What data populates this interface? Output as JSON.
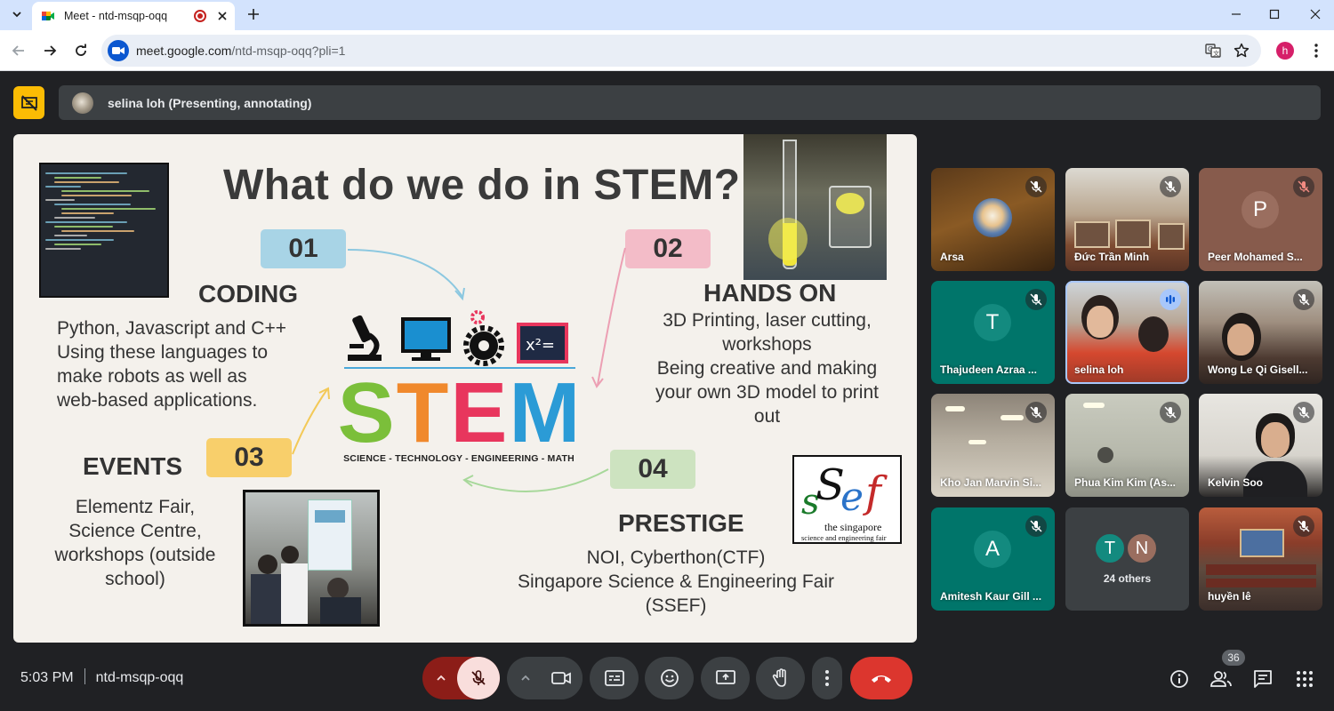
{
  "browser": {
    "tab_title": "Meet - ntd-msqp-oqq",
    "url_host": "meet.google.com",
    "url_path": "/ntd-msqp-oqq?pli=1",
    "profile_initial": "h"
  },
  "header": {
    "presenter_text": "selina loh (Presenting, annotating)"
  },
  "slide": {
    "title": "What do we do in STEM?",
    "stem_letters": [
      "S",
      "T",
      "E",
      "M"
    ],
    "stem_colors": [
      "#7bbf3a",
      "#f0892c",
      "#e8365d",
      "#2b9bd6"
    ],
    "stem_tagline": "SCIENCE - TECHNOLOGY - ENGINEERING - MATH",
    "sections": {
      "coding": {
        "num": "01",
        "heading": "CODING",
        "lines": [
          "Python, Javascript and C++",
          "Using these languages to",
          "make robots as well as",
          "web-based applications."
        ]
      },
      "hands_on": {
        "num": "02",
        "heading": "HANDS ON",
        "lines": [
          "3D Printing, laser cutting,",
          "workshops",
          "Being creative and making",
          "your own 3D model to print",
          "out"
        ]
      },
      "events": {
        "num": "03",
        "heading": "EVENTS",
        "lines": [
          "Elementz Fair,",
          "Science Centre,",
          "workshops (outside",
          "school)"
        ]
      },
      "prestige": {
        "num": "04",
        "heading": "PRESTIGE",
        "lines": [
          "NOI, Cyberthon(CTF)",
          "Singapore Science & Engineering Fair",
          "(SSEF)"
        ]
      }
    },
    "ssef_logo": {
      "letters": [
        "s",
        "S",
        "e",
        "f"
      ],
      "caption1": "the singapore",
      "caption2": "science and engineering fair"
    },
    "badge_colors": {
      "b1": "#a8d4e6",
      "b2": "#f3bcc8",
      "b3": "#f8cf6b",
      "b4": "#cde3c0"
    }
  },
  "participants": [
    {
      "name": "Arsa",
      "kind": "avatar-image",
      "muted": true
    },
    {
      "name": "Đức Trần Minh",
      "kind": "video",
      "muted": true
    },
    {
      "name": "Peer Mohamed S...",
      "kind": "letter",
      "letter": "P",
      "muted": true
    },
    {
      "name": "Thajudeen Azraa ...",
      "kind": "letter",
      "letter": "T",
      "muted": true
    },
    {
      "name": "selina loh",
      "kind": "video",
      "speaking": true
    },
    {
      "name": "Wong Le Qi Gisell...",
      "kind": "video",
      "muted": true
    },
    {
      "name": "Kho Jan Marvin Si...",
      "kind": "video",
      "muted": true
    },
    {
      "name": "Phua Kim Kim (As...",
      "kind": "video",
      "muted": true
    },
    {
      "name": "Kelvin Soo",
      "kind": "video",
      "muted": true
    },
    {
      "name": "Amitesh Kaur Gill ...",
      "kind": "letter",
      "letter": "A",
      "muted": true
    },
    {
      "name": "24 others",
      "kind": "others",
      "letters": [
        "T",
        "N"
      ]
    },
    {
      "name": "huyền lê",
      "kind": "video",
      "muted": true
    }
  ],
  "meeting": {
    "time": "5:03 PM",
    "code": "ntd-msqp-oqq",
    "participant_count": "36"
  }
}
